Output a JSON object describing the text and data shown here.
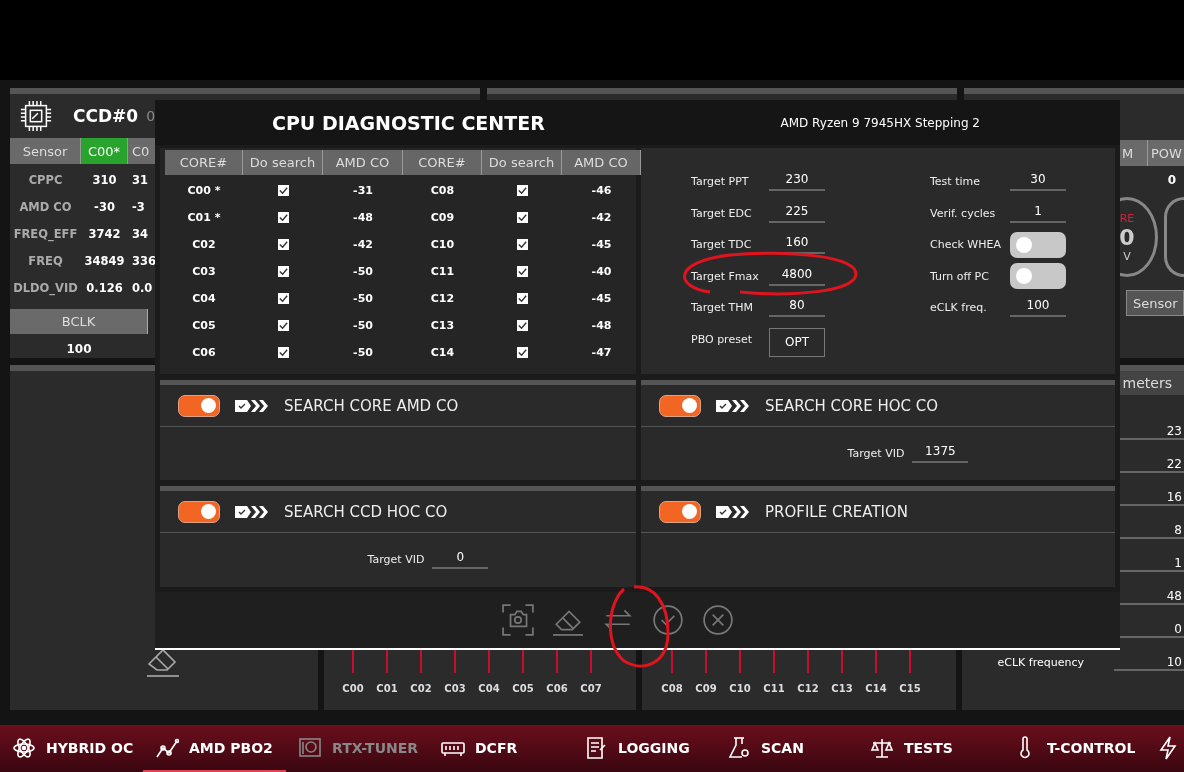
{
  "background": {
    "ccd_panel": {
      "title": "CCD#0",
      "title_suffix": "0",
      "columns": [
        {
          "label": "Sensor",
          "selected": false
        },
        {
          "label": "C00*",
          "selected": true
        },
        {
          "label": "C0",
          "selected": false
        }
      ],
      "rows": [
        {
          "label": "CPPC",
          "values": [
            "310",
            "31"
          ]
        },
        {
          "label": "AMD CO",
          "values": [
            "-30",
            "-3"
          ]
        },
        {
          "label": "FREQ_EFF",
          "values": [
            "3742",
            "34"
          ]
        },
        {
          "label": "FREQ",
          "values": [
            "34849",
            "336"
          ]
        },
        {
          "label": "DLDO_VID",
          "values": [
            "0.126",
            "0.0"
          ]
        }
      ],
      "bclk": {
        "label": "BCLK",
        "value": "100"
      }
    },
    "gpu_panel": {
      "columns": [
        "M",
        "POW"
      ],
      "value": "0",
      "gauge": {
        "label": "RE",
        "value": "0",
        "unit": "V"
      },
      "sensor_button": "Sensor"
    },
    "params_panel": {
      "header": "meters",
      "rows": [
        {
          "value": "23"
        },
        {
          "value": "22"
        },
        {
          "value": "16"
        },
        {
          "value": "8"
        },
        {
          "value": "1"
        },
        {
          "value": "48"
        },
        {
          "value": "0"
        },
        {
          "label": "eCLK frequency",
          "value": "10"
        }
      ]
    },
    "core_bars": [
      {
        "labels": [
          "C00",
          "C01",
          "C02",
          "C03",
          "C04",
          "C05",
          "C06",
          "C07"
        ]
      },
      {
        "labels": [
          "C08",
          "C09",
          "C10",
          "C11",
          "C12",
          "C13",
          "C14",
          "C15"
        ]
      }
    ]
  },
  "dialog": {
    "title": "CPU DIAGNOSTIC CENTER",
    "cpu": "AMD Ryzen 9 7945HX Stepping 2",
    "cores_table": {
      "columns": [
        "CORE#",
        "Do search",
        "AMD CO",
        "CORE#",
        "Do search",
        "AMD CO"
      ],
      "rows": [
        {
          "cells": [
            {
              "kind": "text",
              "text": "C00 *"
            },
            {
              "kind": "checkbox",
              "checked": true
            },
            {
              "kind": "text",
              "text": "-31"
            },
            {
              "kind": "text",
              "text": "C08"
            },
            {
              "kind": "checkbox",
              "checked": true
            },
            {
              "kind": "text",
              "text": "-46"
            }
          ]
        },
        {
          "cells": [
            {
              "kind": "text",
              "text": "C01 *"
            },
            {
              "kind": "checkbox",
              "checked": true
            },
            {
              "kind": "text",
              "text": "-48"
            },
            {
              "kind": "text",
              "text": "C09"
            },
            {
              "kind": "checkbox",
              "checked": true
            },
            {
              "kind": "text",
              "text": "-42"
            }
          ]
        },
        {
          "cells": [
            {
              "kind": "text",
              "text": "C02"
            },
            {
              "kind": "checkbox",
              "checked": true
            },
            {
              "kind": "text",
              "text": "-42"
            },
            {
              "kind": "text",
              "text": "C10"
            },
            {
              "kind": "checkbox",
              "checked": true
            },
            {
              "kind": "text",
              "text": "-45"
            }
          ]
        },
        {
          "cells": [
            {
              "kind": "text",
              "text": "C03"
            },
            {
              "kind": "checkbox",
              "checked": true
            },
            {
              "kind": "text",
              "text": "-50"
            },
            {
              "kind": "text",
              "text": "C11"
            },
            {
              "kind": "checkbox",
              "checked": true
            },
            {
              "kind": "text",
              "text": "-40"
            }
          ]
        },
        {
          "cells": [
            {
              "kind": "text",
              "text": "C04"
            },
            {
              "kind": "checkbox",
              "checked": true
            },
            {
              "kind": "text",
              "text": "-50"
            },
            {
              "kind": "text",
              "text": "C12"
            },
            {
              "kind": "checkbox",
              "checked": true
            },
            {
              "kind": "text",
              "text": "-45"
            }
          ]
        },
        {
          "cells": [
            {
              "kind": "text",
              "text": "C05"
            },
            {
              "kind": "checkbox",
              "checked": true
            },
            {
              "kind": "text",
              "text": "-50"
            },
            {
              "kind": "text",
              "text": "C13"
            },
            {
              "kind": "checkbox",
              "checked": true
            },
            {
              "kind": "text",
              "text": "-48"
            }
          ]
        },
        {
          "cells": [
            {
              "kind": "text",
              "text": "C06"
            },
            {
              "kind": "checkbox",
              "checked": true
            },
            {
              "kind": "text",
              "text": "-50"
            },
            {
              "kind": "text",
              "text": "C14"
            },
            {
              "kind": "checkbox",
              "checked": true
            },
            {
              "kind": "text",
              "text": "-47"
            }
          ]
        }
      ]
    },
    "settings_left": [
      {
        "kind": "field",
        "label": "Target PPT",
        "value": "230"
      },
      {
        "kind": "field",
        "label": "Target EDC",
        "value": "225"
      },
      {
        "kind": "field",
        "label": "Target TDC",
        "value": "160"
      },
      {
        "kind": "field",
        "label": "Target Fmax",
        "value": "4800"
      },
      {
        "kind": "field",
        "label": "Target THM",
        "value": "80"
      },
      {
        "kind": "button",
        "label": "PBO preset",
        "value": "OPT"
      }
    ],
    "settings_right": [
      {
        "kind": "field",
        "label": "Test time",
        "value": "30"
      },
      {
        "kind": "field",
        "label": "Verif. cycles",
        "value": "1"
      },
      {
        "kind": "toggle",
        "label": "Check WHEA",
        "on": false
      },
      {
        "kind": "toggle",
        "label": "Turn off PC",
        "on": false
      },
      {
        "kind": "field",
        "label": "eCLK freq.",
        "value": "100"
      }
    ],
    "modes": [
      {
        "title": "SEARCH CORE AMD CO",
        "on": true
      },
      {
        "title": "SEARCH CORE HOC CO",
        "on": true,
        "fields": [
          {
            "label": "Target VID",
            "value": "1375"
          }
        ]
      },
      {
        "title": "SEARCH CCD HOC CO",
        "on": true,
        "fields": [
          {
            "label": "Target VID",
            "value": "0"
          }
        ]
      },
      {
        "title": "PROFILE CREATION",
        "on": true
      }
    ],
    "footer_buttons": [
      {
        "kind": "camera"
      },
      {
        "kind": "eraser"
      },
      {
        "kind": "swap"
      },
      {
        "kind": "check"
      },
      {
        "kind": "close"
      }
    ]
  },
  "nav": [
    {
      "label": "HYBRID OC",
      "kind": "atom",
      "selected": false,
      "disabled": false
    },
    {
      "label": "AMD PBO2",
      "kind": "graph",
      "selected": true,
      "disabled": false
    },
    {
      "label": "RTX-TUNER",
      "kind": "gpu",
      "selected": false,
      "disabled": true
    },
    {
      "label": "DCFR",
      "kind": "memory",
      "selected": false,
      "disabled": false
    },
    {
      "label": "LOGGING",
      "kind": "notes",
      "selected": false,
      "disabled": false
    },
    {
      "label": "SCAN",
      "kind": "flask",
      "selected": false,
      "disabled": false
    },
    {
      "label": "TESTS",
      "kind": "scales",
      "selected": false,
      "disabled": false
    },
    {
      "label": "T-CONTROL",
      "kind": "thermo",
      "selected": false,
      "disabled": false
    },
    {
      "kind": "bolt",
      "selected": false,
      "disabled": false
    }
  ]
}
